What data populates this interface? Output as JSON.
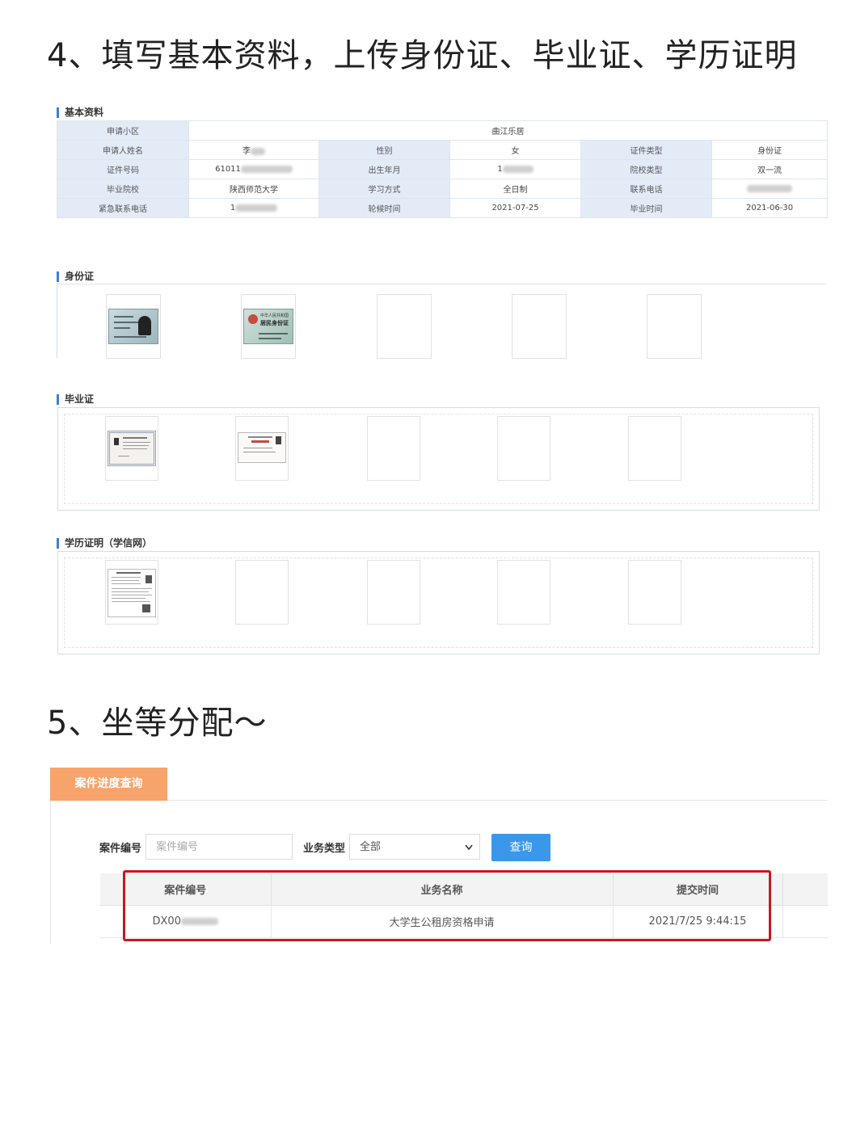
{
  "step4": {
    "title": "4、填写基本资料，上传身份证、毕业证、学历证明"
  },
  "basic_info": {
    "section_label": "基本资料",
    "community_label": "申请小区",
    "community_value": "曲江乐居",
    "rows": [
      [
        {
          "label": "申请人姓名",
          "value": "李"
        },
        {
          "label": "性别",
          "value": "女"
        },
        {
          "label": "证件类型",
          "value": "身份证"
        }
      ],
      [
        {
          "label": "证件号码",
          "value": "61011"
        },
        {
          "label": "出生年月",
          "value": "1"
        },
        {
          "label": "院校类型",
          "value": "双一流"
        }
      ],
      [
        {
          "label": "毕业院校",
          "value": "陕西师范大学"
        },
        {
          "label": "学习方式",
          "value": "全日制"
        },
        {
          "label": "联系电话",
          "value": ""
        }
      ],
      [
        {
          "label": "紧急联系电话",
          "value": "1"
        },
        {
          "label": "轮候时间",
          "value": "2021-07-25"
        },
        {
          "label": "毕业时间",
          "value": "2021-06-30"
        }
      ]
    ]
  },
  "id_card": {
    "section_label": "身份证"
  },
  "diploma": {
    "section_label": "毕业证"
  },
  "education_proof": {
    "section_label": "学历证明（学信网）"
  },
  "id_card_images": {
    "front_text": "中华人民共和国",
    "back_text": "居民身份证"
  },
  "step5": {
    "title": "5、坐等分配～"
  },
  "case_query": {
    "tab_label": "案件进度查询",
    "case_no_label": "案件编号",
    "case_no_placeholder": "案件编号",
    "biz_type_label": "业务类型",
    "biz_type_selected": "全部",
    "query_button": "查询",
    "columns": [
      "案件编号",
      "业务名称",
      "提交时间"
    ],
    "rows": [
      [
        "DX00",
        "大学生公租房资格申请",
        "2021/7/25 9:44:15"
      ]
    ]
  }
}
